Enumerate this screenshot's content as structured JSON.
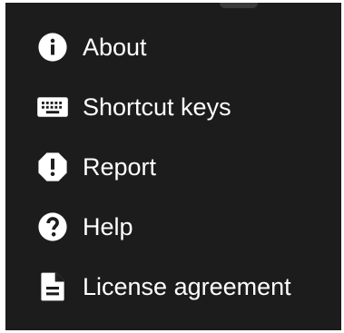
{
  "menu": {
    "items": [
      {
        "label": "About",
        "icon": "info-icon"
      },
      {
        "label": "Shortcut keys",
        "icon": "keyboard-icon"
      },
      {
        "label": "Report",
        "icon": "report-icon"
      },
      {
        "label": "Help",
        "icon": "help-icon"
      },
      {
        "label": "License agreement",
        "icon": "document-icon"
      }
    ]
  },
  "colors": {
    "menu_background": "#1c1c1c",
    "text": "#ffffff",
    "icon": "#ffffff"
  }
}
